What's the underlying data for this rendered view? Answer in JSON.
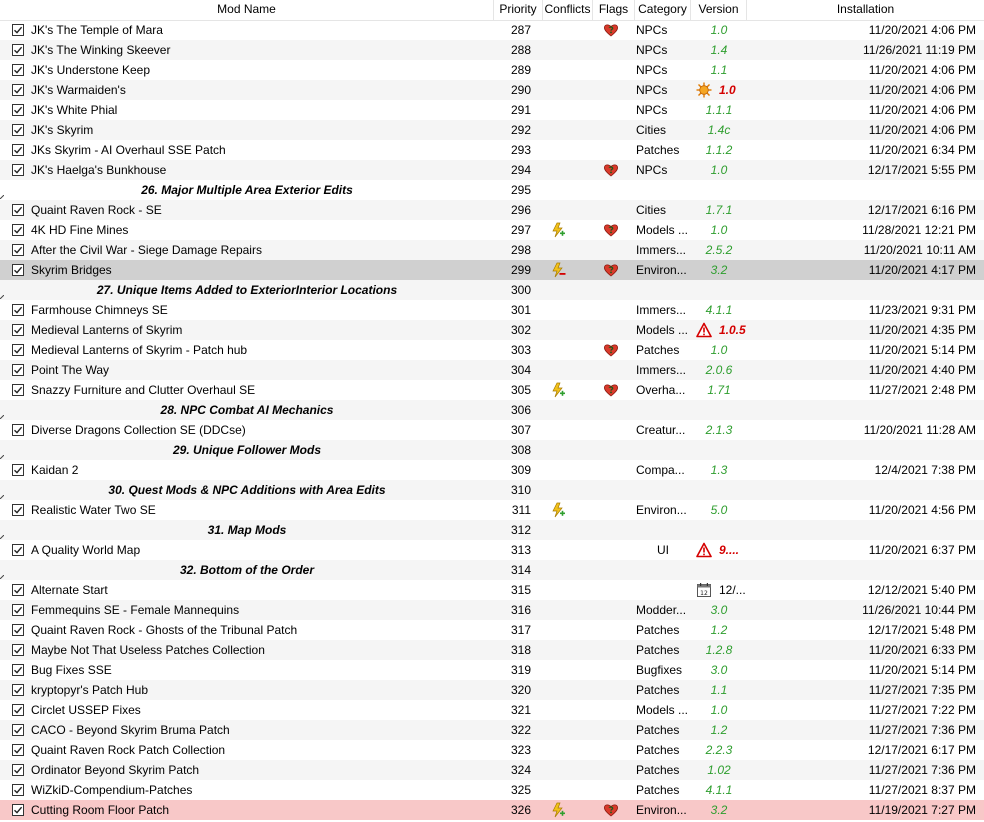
{
  "columns": {
    "name": "Mod Name",
    "priority": "Priority",
    "conflicts": "Conflicts",
    "flags": "Flags",
    "category": "Category",
    "version": "Version",
    "installation": "Installation"
  },
  "colors": {
    "version_ok": "#2e9e2e",
    "version_warn": "#d40000",
    "row_alt": "#f5f5f5",
    "row_selected": "#d0d0d0",
    "row_highlight": "#f8c8c8"
  },
  "rows": [
    {
      "name": "JK's The Temple of Mara",
      "priority": "287",
      "conflict": "",
      "flag": "heart",
      "category": "NPCs",
      "version": "1.0",
      "vicon": "",
      "vtype": "ok",
      "install": "11/20/2021 4:06 PM"
    },
    {
      "name": "JK's The Winking Skeever",
      "priority": "288",
      "conflict": "",
      "flag": "",
      "category": "NPCs",
      "version": "1.4",
      "vicon": "",
      "vtype": "ok",
      "install": "11/26/2021 11:19 PM"
    },
    {
      "name": "JK's Understone Keep",
      "priority": "289",
      "conflict": "",
      "flag": "",
      "category": "NPCs",
      "version": "1.1",
      "vicon": "",
      "vtype": "ok",
      "install": "11/20/2021 4:06 PM"
    },
    {
      "name": "JK's Warmaiden's",
      "priority": "290",
      "conflict": "",
      "flag": "",
      "category": "NPCs",
      "version": "1.0",
      "vicon": "sun",
      "vtype": "warn",
      "install": "11/20/2021 4:06 PM"
    },
    {
      "name": "JK's White Phial",
      "priority": "291",
      "conflict": "",
      "flag": "",
      "category": "NPCs",
      "version": "1.1.1",
      "vicon": "",
      "vtype": "ok",
      "install": "11/20/2021 4:06 PM"
    },
    {
      "name": "JK's Skyrim",
      "priority": "292",
      "conflict": "",
      "flag": "",
      "category": "Cities",
      "version": "1.4c",
      "vicon": "",
      "vtype": "ok",
      "install": "11/20/2021 4:06 PM"
    },
    {
      "name": "JKs Skyrim - AI Overhaul SSE Patch",
      "priority": "293",
      "conflict": "",
      "flag": "",
      "category": "Patches",
      "version": "1.1.2",
      "vicon": "",
      "vtype": "ok",
      "install": "11/20/2021 6:34 PM"
    },
    {
      "name": "JK's Haelga's Bunkhouse",
      "priority": "294",
      "conflict": "",
      "flag": "heart",
      "category": "NPCs",
      "version": "1.0",
      "vicon": "",
      "vtype": "ok",
      "install": "12/17/2021 5:55 PM"
    },
    {
      "sep": true,
      "name": "26. Major Multiple Area Exterior Edits",
      "priority": "295"
    },
    {
      "name": "Quaint Raven Rock - SE",
      "priority": "296",
      "conflict": "",
      "flag": "",
      "category": "Cities",
      "version": "1.7.1",
      "vicon": "",
      "vtype": "ok",
      "install": "12/17/2021 6:16 PM"
    },
    {
      "name": "4K HD Fine Mines",
      "priority": "297",
      "conflict": "plus",
      "flag": "heart",
      "category": "Models ...",
      "version": "1.0",
      "vicon": "",
      "vtype": "ok",
      "install": "11/28/2021 12:21 PM"
    },
    {
      "name": "After the Civil War - Siege Damage Repairs",
      "priority": "298",
      "conflict": "",
      "flag": "",
      "category": "Immers...",
      "version": "2.5.2",
      "vicon": "",
      "vtype": "ok",
      "install": "11/20/2021 10:11 AM"
    },
    {
      "name": "Skyrim Bridges",
      "priority": "299",
      "conflict": "minus",
      "flag": "heart",
      "category": "Environ...",
      "version": "3.2",
      "vicon": "",
      "vtype": "ok",
      "install": "11/20/2021 4:17 PM",
      "state": "sel"
    },
    {
      "sep": true,
      "name": "27. Unique Items Added to ExteriorInterior Locations",
      "priority": "300"
    },
    {
      "name": "Farmhouse Chimneys SE",
      "priority": "301",
      "conflict": "",
      "flag": "",
      "category": "Immers...",
      "version": "4.1.1",
      "vicon": "",
      "vtype": "ok",
      "install": "11/23/2021 9:31 PM"
    },
    {
      "name": "Medieval Lanterns of Skyrim",
      "priority": "302",
      "conflict": "",
      "flag": "",
      "category": "Models ...",
      "version": "1.0.5",
      "vicon": "warning",
      "vtype": "warn",
      "install": "11/20/2021 4:35 PM"
    },
    {
      "name": "Medieval Lanterns of Skyrim - Patch hub",
      "priority": "303",
      "conflict": "",
      "flag": "heart",
      "category": "Patches",
      "version": "1.0",
      "vicon": "",
      "vtype": "ok",
      "install": "11/20/2021 5:14 PM"
    },
    {
      "name": "Point The Way",
      "priority": "304",
      "conflict": "",
      "flag": "",
      "category": "Immers...",
      "version": "2.0.6",
      "vicon": "",
      "vtype": "ok",
      "install": "11/20/2021 4:40 PM"
    },
    {
      "name": "Snazzy Furniture and Clutter Overhaul SE",
      "priority": "305",
      "conflict": "plus",
      "flag": "heart",
      "category": "Overha...",
      "version": "1.71",
      "vicon": "",
      "vtype": "ok",
      "install": "11/27/2021 2:48 PM"
    },
    {
      "sep": true,
      "name": "28. NPC Combat AI Mechanics",
      "priority": "306"
    },
    {
      "name": "Diverse Dragons Collection SE (DDCse)",
      "priority": "307",
      "conflict": "",
      "flag": "",
      "category": "Creatur...",
      "version": "2.1.3",
      "vicon": "",
      "vtype": "ok",
      "install": "11/20/2021 11:28 AM"
    },
    {
      "sep": true,
      "name": "29. Unique Follower Mods",
      "priority": "308"
    },
    {
      "name": "Kaidan 2",
      "priority": "309",
      "conflict": "",
      "flag": "",
      "category": "Compa...",
      "version": "1.3",
      "vicon": "",
      "vtype": "ok",
      "install": "12/4/2021 7:38 PM"
    },
    {
      "sep": true,
      "name": "30. Quest Mods & NPC Additions with Area Edits",
      "priority": "310"
    },
    {
      "name": "Realistic Water Two SE",
      "priority": "311",
      "conflict": "plus",
      "flag": "",
      "category": "Environ...",
      "version": "5.0",
      "vicon": "",
      "vtype": "ok",
      "install": "11/20/2021 4:56 PM"
    },
    {
      "sep": true,
      "name": "31. Map Mods",
      "priority": "312"
    },
    {
      "name": "A Quality World Map",
      "priority": "313",
      "conflict": "",
      "flag": "",
      "category": "UI",
      "version": "9....",
      "vicon": "warning",
      "vtype": "warn",
      "install": "11/20/2021 6:37 PM",
      "catcenter": true
    },
    {
      "sep": true,
      "name": "32. Bottom of the Order",
      "priority": "314"
    },
    {
      "name": "Alternate Start",
      "priority": "315",
      "conflict": "",
      "flag": "",
      "category": "",
      "version": "12/...",
      "vicon": "calendar",
      "vtype": "plain",
      "install": "12/12/2021 5:40 PM"
    },
    {
      "name": "Femmequins SE - Female Mannequins",
      "priority": "316",
      "conflict": "",
      "flag": "",
      "category": "Modder...",
      "version": "3.0",
      "vicon": "",
      "vtype": "ok",
      "install": "11/26/2021 10:44 PM"
    },
    {
      "name": "Quaint Raven Rock - Ghosts of the Tribunal Patch",
      "priority": "317",
      "conflict": "",
      "flag": "",
      "category": "Patches",
      "version": "1.2",
      "vicon": "",
      "vtype": "ok",
      "install": "12/17/2021 5:48 PM"
    },
    {
      "name": "Maybe Not That Useless Patches Collection",
      "priority": "318",
      "conflict": "",
      "flag": "",
      "category": "Patches",
      "version": "1.2.8",
      "vicon": "",
      "vtype": "ok",
      "install": "11/20/2021 6:33 PM"
    },
    {
      "name": "Bug Fixes SSE",
      "priority": "319",
      "conflict": "",
      "flag": "",
      "category": "Bugfixes",
      "version": "3.0",
      "vicon": "",
      "vtype": "ok",
      "install": "11/20/2021 5:14 PM"
    },
    {
      "name": "kryptopyr's Patch Hub",
      "priority": "320",
      "conflict": "",
      "flag": "",
      "category": "Patches",
      "version": "1.1",
      "vicon": "",
      "vtype": "ok",
      "install": "11/27/2021 7:35 PM"
    },
    {
      "name": "Circlet USSEP Fixes",
      "priority": "321",
      "conflict": "",
      "flag": "",
      "category": "Models ...",
      "version": "1.0",
      "vicon": "",
      "vtype": "ok",
      "install": "11/27/2021 7:22 PM"
    },
    {
      "name": "CACO - Beyond Skyrim Bruma Patch",
      "priority": "322",
      "conflict": "",
      "flag": "",
      "category": "Patches",
      "version": "1.2",
      "vicon": "",
      "vtype": "ok",
      "install": "11/27/2021 7:36 PM"
    },
    {
      "name": "Quaint Raven Rock Patch Collection",
      "priority": "323",
      "conflict": "",
      "flag": "",
      "category": "Patches",
      "version": "2.2.3",
      "vicon": "",
      "vtype": "ok",
      "install": "12/17/2021 6:17 PM"
    },
    {
      "name": "Ordinator Beyond Skyrim Patch",
      "priority": "324",
      "conflict": "",
      "flag": "",
      "category": "Patches",
      "version": "1.02",
      "vicon": "",
      "vtype": "ok",
      "install": "11/27/2021 7:36 PM"
    },
    {
      "name": "WiZkiD-Compendium-Patches",
      "priority": "325",
      "conflict": "",
      "flag": "",
      "category": "Patches",
      "version": "4.1.1",
      "vicon": "",
      "vtype": "ok",
      "install": "11/27/2021 8:37 PM"
    },
    {
      "name": "Cutting Room Floor Patch",
      "priority": "326",
      "conflict": "plus",
      "flag": "heart",
      "category": "Environ...",
      "version": "3.2",
      "vicon": "",
      "vtype": "ok",
      "install": "11/19/2021 7:27 PM",
      "state": "hl"
    }
  ]
}
